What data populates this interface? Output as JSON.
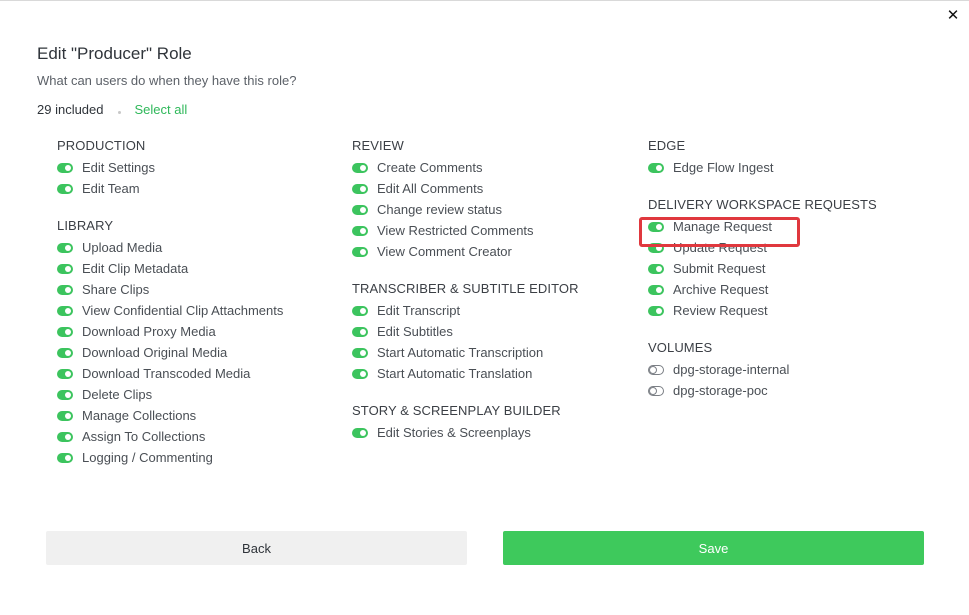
{
  "dialog": {
    "title": "Edit \"Producer\" Role",
    "subtitle": "What can users do when they have this role?",
    "included_count": "29 included",
    "select_all_label": "Select all",
    "close_label": "✕",
    "back_label": "Back",
    "save_label": "Save"
  },
  "colors": {
    "toggle_on": "#3cc45e",
    "save_button": "#3ec95c",
    "accent_link": "#2fb85a",
    "highlight_border": "#e0383e"
  },
  "sections": {
    "production": {
      "title": "PRODUCTION",
      "items": [
        {
          "label": "Edit Settings",
          "enabled": true
        },
        {
          "label": "Edit Team",
          "enabled": true
        }
      ]
    },
    "library": {
      "title": "LIBRARY",
      "items": [
        {
          "label": "Upload Media",
          "enabled": true
        },
        {
          "label": "Edit Clip Metadata",
          "enabled": true
        },
        {
          "label": "Share Clips",
          "enabled": true
        },
        {
          "label": "View Confidential Clip Attachments",
          "enabled": true
        },
        {
          "label": "Download Proxy Media",
          "enabled": true
        },
        {
          "label": "Download Original Media",
          "enabled": true
        },
        {
          "label": "Download Transcoded Media",
          "enabled": true
        },
        {
          "label": "Delete Clips",
          "enabled": true
        },
        {
          "label": "Manage Collections",
          "enabled": true
        },
        {
          "label": "Assign To Collections",
          "enabled": true
        },
        {
          "label": "Logging / Commenting",
          "enabled": true
        }
      ]
    },
    "review": {
      "title": "REVIEW",
      "items": [
        {
          "label": "Create Comments",
          "enabled": true
        },
        {
          "label": "Edit All Comments",
          "enabled": true
        },
        {
          "label": "Change review status",
          "enabled": true
        },
        {
          "label": "View Restricted Comments",
          "enabled": true
        },
        {
          "label": "View Comment Creator",
          "enabled": true
        }
      ]
    },
    "transcriber": {
      "title": "TRANSCRIBER & SUBTITLE EDITOR",
      "items": [
        {
          "label": "Edit Transcript",
          "enabled": true
        },
        {
          "label": "Edit Subtitles",
          "enabled": true
        },
        {
          "label": "Start Automatic Transcription",
          "enabled": true
        },
        {
          "label": "Start Automatic Translation",
          "enabled": true
        }
      ]
    },
    "story": {
      "title": "STORY & SCREENPLAY BUILDER",
      "items": [
        {
          "label": "Edit Stories & Screenplays",
          "enabled": true
        }
      ]
    },
    "edge": {
      "title": "EDGE",
      "items": [
        {
          "label": "Edge Flow Ingest",
          "enabled": true
        }
      ]
    },
    "delivery": {
      "title": "DELIVERY WORKSPACE REQUESTS",
      "items": [
        {
          "label": "Manage Request",
          "enabled": true
        },
        {
          "label": "Update Request",
          "enabled": true
        },
        {
          "label": "Submit Request",
          "enabled": true
        },
        {
          "label": "Archive Request",
          "enabled": true
        },
        {
          "label": "Review Request",
          "enabled": true
        }
      ]
    },
    "volumes": {
      "title": "VOLUMES",
      "items": [
        {
          "label": "dpg-storage-internal",
          "enabled": false
        },
        {
          "label": "dpg-storage-poc",
          "enabled": false
        }
      ]
    }
  }
}
